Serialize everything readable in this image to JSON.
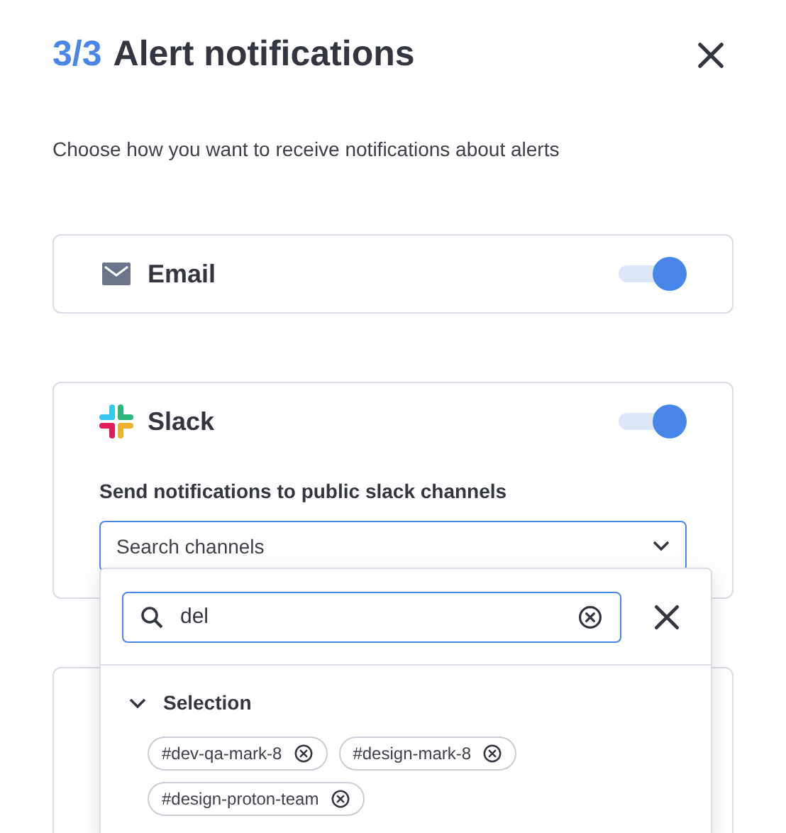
{
  "header": {
    "step": "3/3",
    "title": "Alert notifications"
  },
  "description": "Choose how you want to receive notifications about alerts",
  "channels": [
    {
      "kind": "email",
      "name": "Email",
      "on": true
    },
    {
      "kind": "slack",
      "name": "Slack",
      "on": true,
      "field_label": "Send notifications to public slack channels",
      "select": {
        "placeholder": "Search channels",
        "expanded": true
      }
    },
    {
      "kind": "blank"
    }
  ],
  "dropdown": {
    "search_value": "del",
    "section": {
      "title": "Selection",
      "expanded": true
    },
    "chips": [
      {
        "label": "#dev-qa-mark-8"
      },
      {
        "label": "#design-mark-8"
      },
      {
        "label": "#design-proton-team"
      }
    ]
  }
}
